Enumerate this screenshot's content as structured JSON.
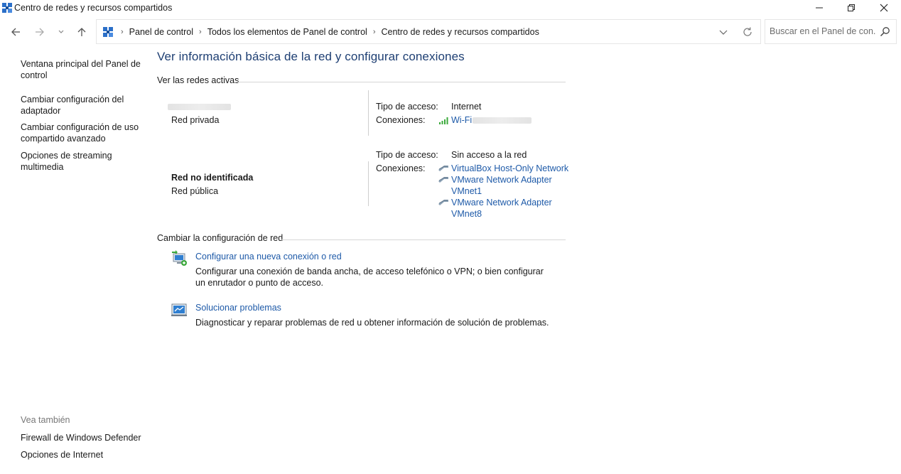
{
  "window": {
    "title": "Centro de redes y recursos compartidos",
    "minimize_glyph": "—",
    "maximize_glyph": "❐",
    "close_glyph": "✕"
  },
  "address_bar": {
    "crumbs": [
      "Panel de control",
      "Todos los elementos de Panel de control",
      "Centro de redes y recursos compartidos"
    ],
    "separator": "›"
  },
  "search": {
    "placeholder": "Buscar en el Panel de con..."
  },
  "sidebar": {
    "items": [
      {
        "label": "Ventana principal del Panel de control"
      },
      {
        "label": "Cambiar configuración del adaptador"
      },
      {
        "label": "Cambiar configuración de uso compartido avanzado"
      },
      {
        "label": "Opciones de streaming multimedia"
      }
    ],
    "see_also_header": "Vea también",
    "see_also": [
      {
        "label": "Firewall de Windows Defender"
      },
      {
        "label": "Opciones de Internet"
      }
    ]
  },
  "main": {
    "title": "Ver información básica de la red y configurar conexiones",
    "active_networks_header": "Ver las redes activas",
    "networks": [
      {
        "name": "",
        "category": "Red privada",
        "access_label": "Tipo de acceso:",
        "access_value": "Internet",
        "connections_label": "Conexiones:",
        "connections": [
          "Wi-Fi"
        ]
      },
      {
        "name": "Red no identificada",
        "category": "Red pública",
        "access_label": "Tipo de acceso:",
        "access_value": "Sin acceso a la red",
        "connections_label": "Conexiones:",
        "connections": [
          "VirtualBox Host-Only Network",
          "VMware Network Adapter",
          "VMnet1",
          "VMware Network Adapter",
          "VMnet8"
        ]
      }
    ],
    "change_settings_header": "Cambiar la configuración de red",
    "tasks": [
      {
        "link": "Configurar una nueva conexión o red",
        "description": "Configurar una conexión de banda ancha, de acceso telefónico o VPN; o bien configurar un enrutador o punto de acceso."
      },
      {
        "link": "Solucionar problemas",
        "description": "Diagnosticar y reparar problemas de red u obtener información de solución de problemas."
      }
    ]
  },
  "colors": {
    "link": "#1e5aa8",
    "title": "#1e3f73",
    "wifi": "#3aa83a"
  }
}
